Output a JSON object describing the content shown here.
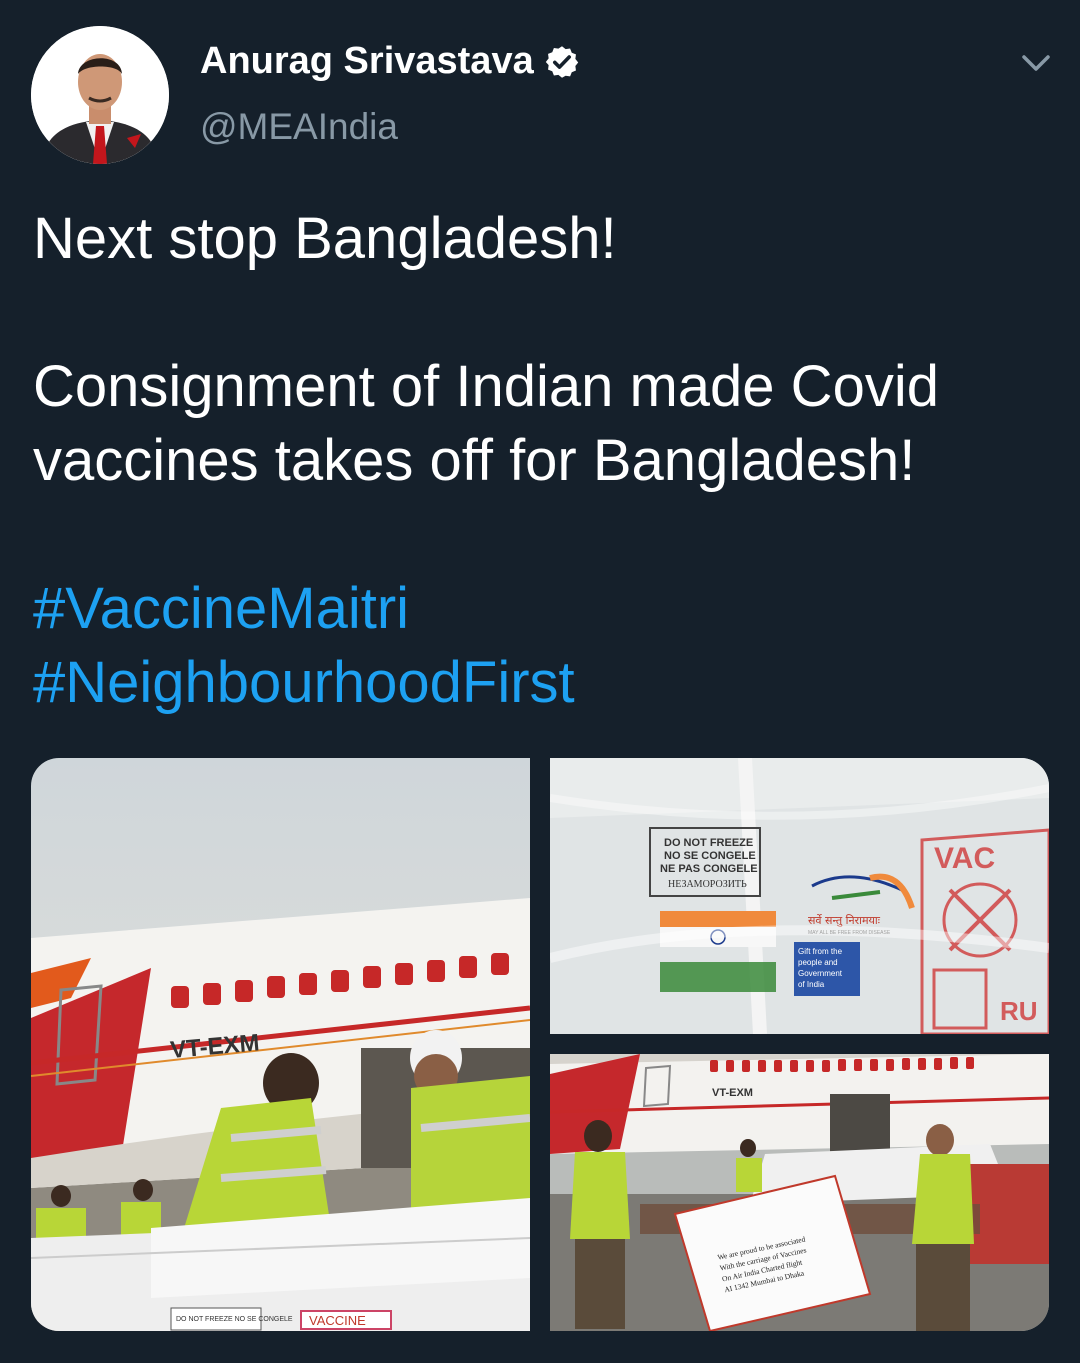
{
  "author": {
    "display_name": "Anurag Srivastava",
    "handle": "@MEAIndia",
    "verified": true
  },
  "tweet": {
    "line1": "Next stop Bangladesh!",
    "line2": "Consignment of Indian made Covid vaccines takes off for Bangladesh!",
    "hashtag1": "#VaccineMaitri",
    "hashtag2": "#NeighbourhoodFirst"
  },
  "photos": {
    "p1": {
      "registration": "VT-EXM",
      "box_label": "VACCINE",
      "small_label": "DO NOT FREEZE NO SE CONGELE"
    },
    "p2": {
      "stamp_line1": "DO NOT FREEZE",
      "stamp_line2": "NO SE CONGELE",
      "stamp_line3": "NE PAS CONGELE",
      "stamp_line4": "НЕЗАМОРОЗИТЬ",
      "logo_text": "सर्वे सन्तु निरामयाः",
      "logo_sub": "MAY ALL BE FREE FROM DISEASE",
      "gift_line1": "Gift from the",
      "gift_line2": "people and",
      "gift_line3": "Government",
      "gift_line4": "of India",
      "vac_text": "VAC",
      "ru_text": "RU"
    },
    "p3": {
      "registration": "VT-EXM",
      "banner_line1": "We are proud to be associated",
      "banner_line2": "With the carriage of Vaccines",
      "banner_line3": "On Air India Charted flight",
      "banner_line4": "AI 1342 Mumbai to Dhaka"
    }
  },
  "colors": {
    "background": "#15202b",
    "secondary_text": "#8899a6",
    "link": "#1da1f2"
  },
  "icons": {
    "verified": "verified-badge-icon",
    "menu": "chevron-down-icon"
  }
}
